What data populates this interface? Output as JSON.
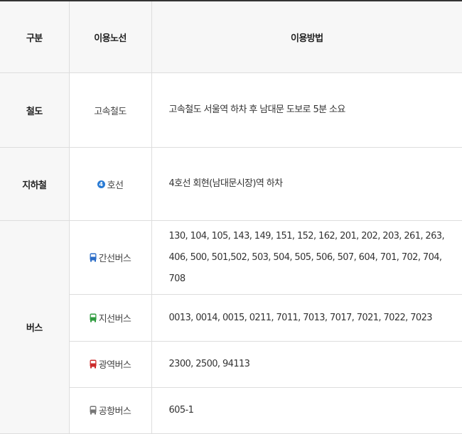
{
  "header": {
    "category": "구분",
    "line": "이용노선",
    "method": "이용방법"
  },
  "rows": [
    {
      "category": "철도",
      "line": "고속철도",
      "method": "고속철도 서울역 하차 후 남대문 도보로 5분 소요"
    },
    {
      "category": "지하철",
      "badge": "4",
      "line": "호선",
      "method": "4호선 회현(남대문시장)역 하차"
    }
  ],
  "bus": {
    "category": "버스",
    "items": [
      {
        "icon": "bus-icon",
        "color": "#2a6cc7",
        "line": "간선버스",
        "method": "130, 104, 105, 143, 149, 151, 152, 162, 201, 202, 203, 261, 263, 406, 500, 501,502, 503, 504, 505, 506, 507, 604, 701, 702, 704, 708"
      },
      {
        "icon": "bus-icon",
        "color": "#2e9b3e",
        "line": "지선버스",
        "method": "0013, 0014, 0015, 0211, 7011, 7013, 7017, 7021, 7022, 7023"
      },
      {
        "icon": "bus-icon",
        "color": "#cc2a2a",
        "line": "광역버스",
        "method": "2300, 2500, 94113"
      },
      {
        "icon": "bus-icon",
        "color": "#777777",
        "line": "공항버스",
        "method": "605-1"
      }
    ]
  },
  "colors": {
    "subway_line4": "#2a7bd4",
    "header_bg": "#f7f7f7",
    "border": "#dddddd"
  }
}
